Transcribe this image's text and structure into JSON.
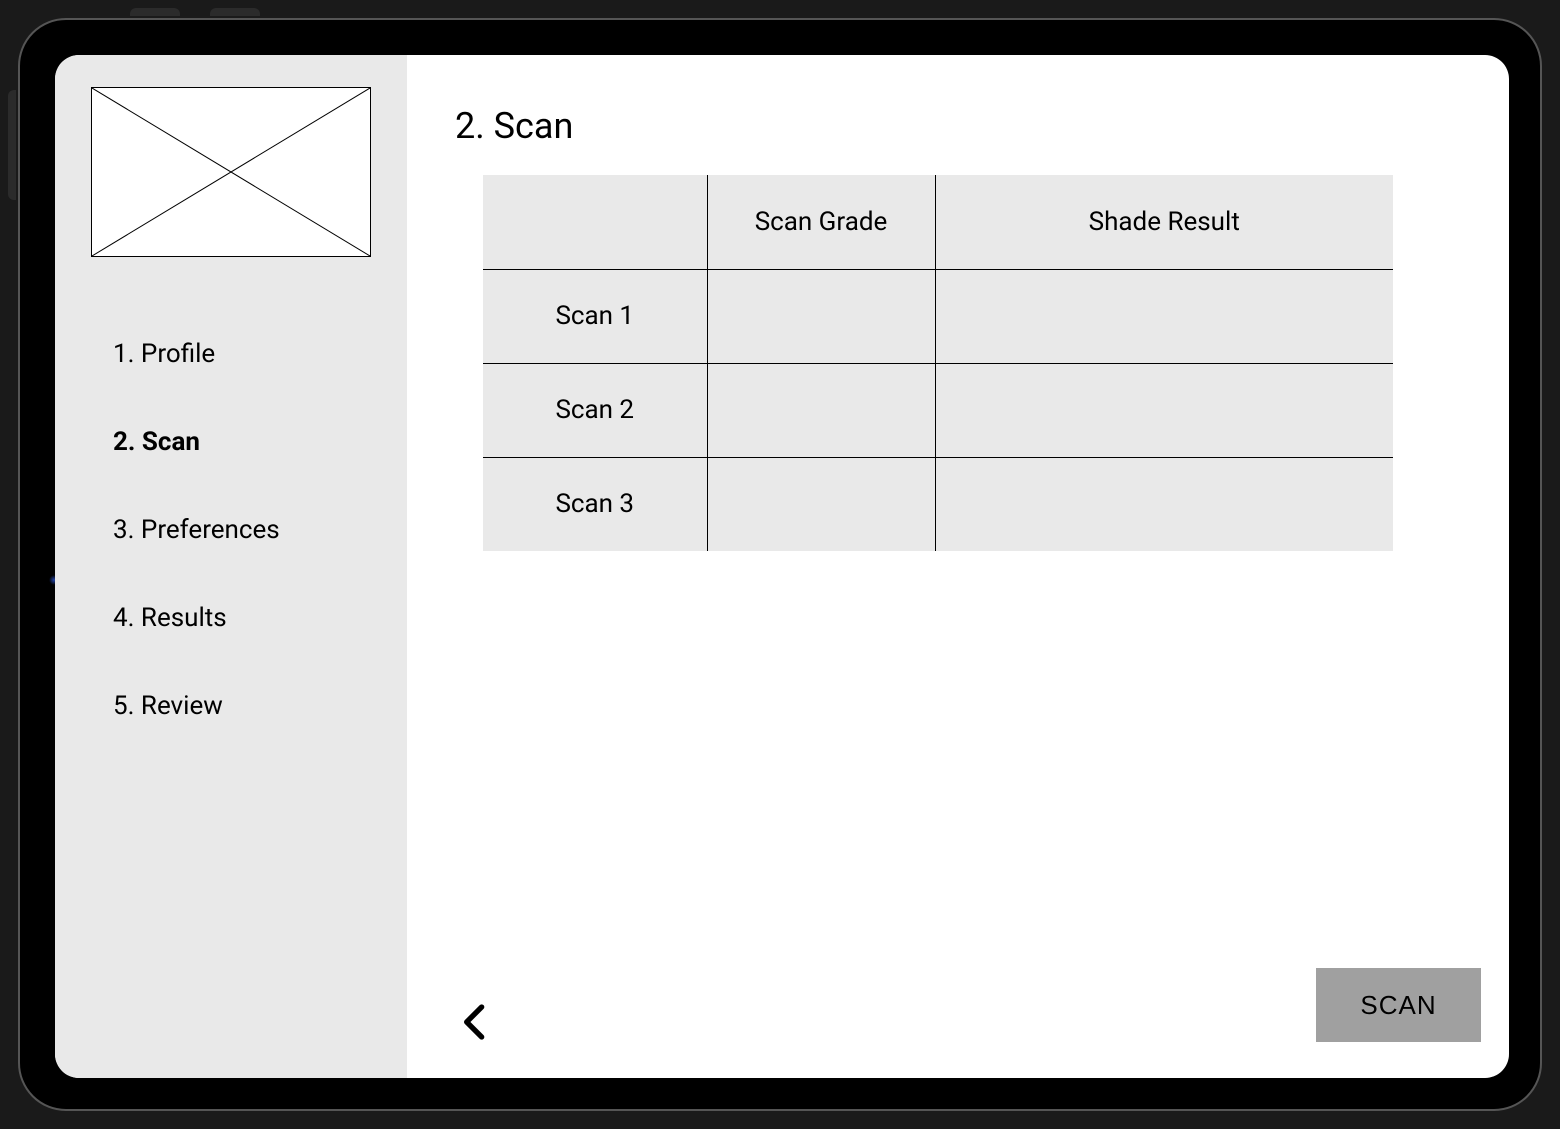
{
  "sidebar": {
    "nav": [
      {
        "label": "1.  Profile"
      },
      {
        "label": "2.  Scan"
      },
      {
        "label": "3.  Preferences"
      },
      {
        "label": "4.  Results"
      },
      {
        "label": "5.  Review"
      }
    ],
    "active_index": 1
  },
  "main": {
    "title": "2. Scan",
    "table": {
      "headers": [
        "",
        "Scan Grade",
        "Shade Result"
      ],
      "rows": [
        {
          "label": "Scan 1",
          "grade": "",
          "shade": ""
        },
        {
          "label": "Scan 2",
          "grade": "",
          "shade": ""
        },
        {
          "label": "Scan 3",
          "grade": "",
          "shade": ""
        }
      ]
    },
    "scan_button": "SCAN"
  }
}
